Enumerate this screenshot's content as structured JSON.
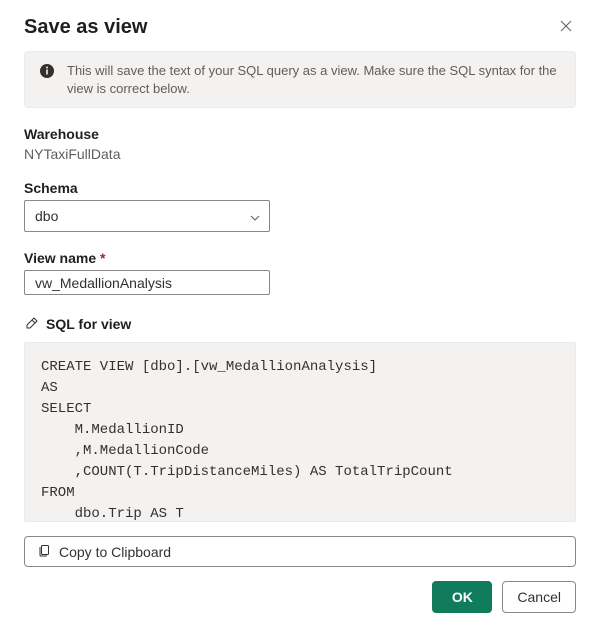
{
  "dialog": {
    "title": "Save as view",
    "info": "This will save the text of your SQL query as a view. Make sure the SQL syntax for the view is correct below."
  },
  "warehouse": {
    "label": "Warehouse",
    "value": "NYTaxiFullData"
  },
  "schema": {
    "label": "Schema",
    "value": "dbo"
  },
  "viewName": {
    "label": "View name",
    "value": "vw_MedallionAnalysis"
  },
  "sql": {
    "header": "SQL for view",
    "code": "CREATE VIEW [dbo].[vw_MedallionAnalysis]\nAS\nSELECT\n    M.MedallionID\n    ,M.MedallionCode\n    ,COUNT(T.TripDistanceMiles) AS TotalTripCount\nFROM\n    dbo.Trip AS T\nJOIN\n    dbo.Medallion AS M"
  },
  "buttons": {
    "copy": "Copy to Clipboard",
    "ok": "OK",
    "cancel": "Cancel"
  }
}
